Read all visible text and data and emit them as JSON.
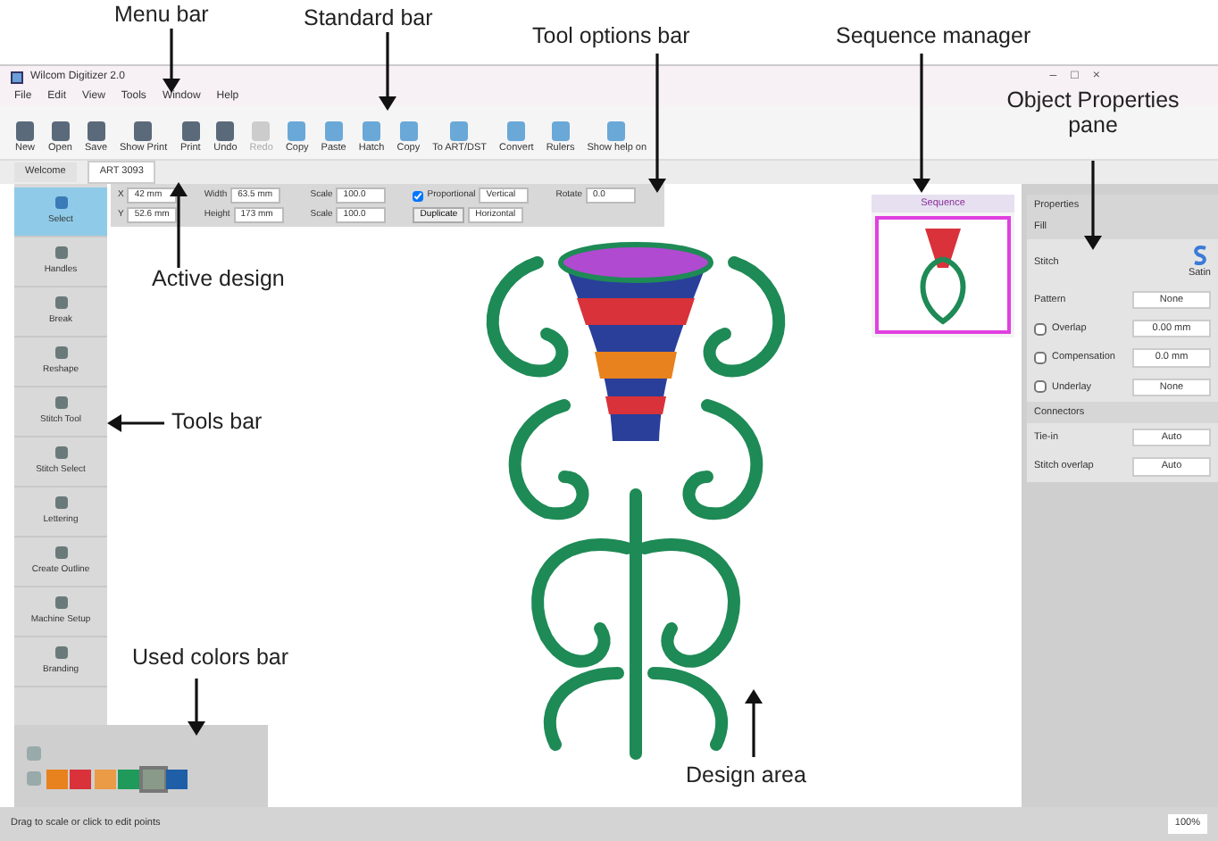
{
  "annotations": [
    {
      "text": "Menu bar"
    },
    {
      "text": "Standard bar"
    },
    {
      "text": "Tool options bar"
    },
    {
      "text": "Sequence manager"
    },
    {
      "text": "Object Properties pane"
    },
    {
      "text": "Active design"
    },
    {
      "text": "Tools bar"
    },
    {
      "text": "Used colors bar"
    },
    {
      "text": "Design area"
    }
  ],
  "window": {
    "title": "Wilcom Digitizer 2.0",
    "controls": [
      "–",
      "□",
      "×"
    ]
  },
  "menu": [
    "File",
    "Edit",
    "View",
    "Tools",
    "Window",
    "Help"
  ],
  "toolbar": [
    {
      "label": "New",
      "disabled": false
    },
    {
      "label": "Open",
      "disabled": false
    },
    {
      "label": "Save",
      "disabled": false
    },
    {
      "label": "Show Print",
      "disabled": false
    },
    {
      "label": "Print",
      "disabled": false
    },
    {
      "label": "Undo",
      "disabled": false
    },
    {
      "label": "Redo",
      "disabled": true
    },
    {
      "label": "Copy",
      "disabled": false
    },
    {
      "label": "Paste",
      "disabled": false
    },
    {
      "label": "Hatch",
      "disabled": false
    },
    {
      "label": "Copy",
      "disabled": false
    },
    {
      "label": "To ART/DST",
      "disabled": false
    },
    {
      "label": "Convert",
      "disabled": false
    },
    {
      "label": "Rulers",
      "disabled": false
    },
    {
      "label": "Show help on",
      "disabled": false
    }
  ],
  "design_tabs": [
    {
      "label": "Welcome",
      "selected": false
    },
    {
      "label": "ART 3093",
      "selected": true
    }
  ],
  "tools": [
    {
      "label": "Select",
      "selected": true
    },
    {
      "label": "Handles",
      "selected": false
    },
    {
      "label": "Break",
      "selected": false
    },
    {
      "label": "Reshape",
      "selected": false
    },
    {
      "label": "Stitch Tool",
      "selected": false
    },
    {
      "label": "Stitch Select",
      "selected": false
    },
    {
      "label": "Lettering",
      "selected": false
    },
    {
      "label": "Create Outline",
      "selected": false
    },
    {
      "label": "Machine Setup",
      "selected": false
    },
    {
      "label": "Branding",
      "selected": false
    }
  ],
  "tool_options": [
    {
      "label": "X",
      "value": "42 mm"
    },
    {
      "label": "Width",
      "value": "63.5 mm"
    },
    {
      "label": "Scale",
      "value": "100.0"
    },
    {
      "label": "Proportional",
      "value": "Vertical",
      "kind": "check",
      "checked": true
    },
    {
      "label": "Rotate",
      "value": "0.0"
    },
    {
      "label": "Y",
      "value": "52.6 mm"
    },
    {
      "label": "Height",
      "value": "173 mm"
    },
    {
      "label": "Scale",
      "value": "100.0"
    },
    {
      "label": "Duplicate",
      "value": "Horizontal",
      "kind": "button"
    }
  ],
  "sequence": {
    "title": "Sequence"
  },
  "properties": {
    "title": "Properties",
    "section": "Fill",
    "stitch_label": "Stitch",
    "stitch_type": "Satin",
    "pattern_label": "Pattern",
    "pattern_value": "None",
    "options": [
      {
        "label": "Overlap",
        "value": "0.00 mm",
        "checked": false
      },
      {
        "label": "Compensation",
        "value": "0.0 mm",
        "checked": false
      },
      {
        "label": "Underlay",
        "value": "None",
        "checked": false
      }
    ],
    "connectors_title": "Connectors",
    "connectors": [
      {
        "label": "Tie-in",
        "value": "Auto"
      },
      {
        "label": "Stitch overlap",
        "value": "Auto"
      }
    ]
  },
  "used_colors": [
    {
      "color": "#e8821e",
      "selected": false
    },
    {
      "color": "#d9323a",
      "selected": false
    },
    {
      "color": "#eb9a45",
      "selected": false
    },
    {
      "color": "#1f9a5a",
      "selected": false
    },
    {
      "color": "#8a9a8a",
      "selected": true
    },
    {
      "color": "#1f5fa8",
      "selected": false
    }
  ],
  "status_bar": {
    "text": "Drag to scale or click to edit points",
    "zoom": "100%"
  }
}
